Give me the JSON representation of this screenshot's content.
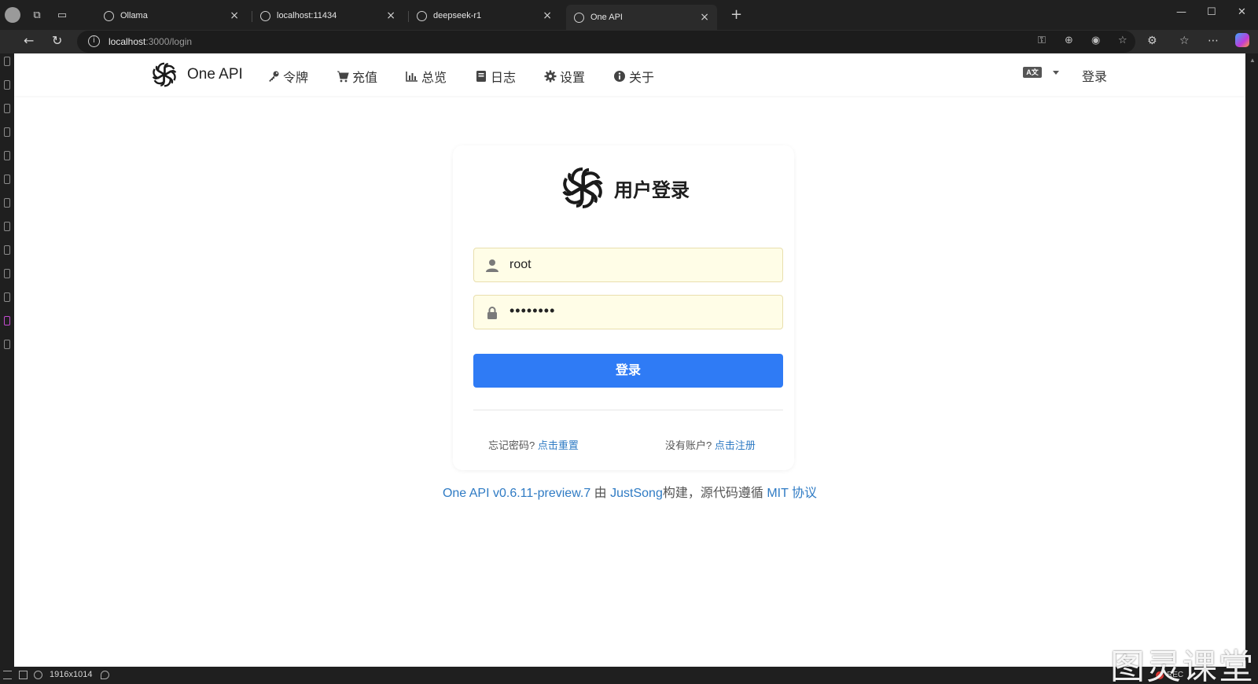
{
  "browser": {
    "tabs": [
      {
        "title": "Ollama"
      },
      {
        "title": "localhost:11434"
      },
      {
        "title": "deepseek-r1"
      },
      {
        "title": "One API"
      }
    ],
    "url_host": "localhost",
    "url_path": ":3000/login"
  },
  "header": {
    "brand": "One API",
    "nav": [
      {
        "label": "令牌",
        "icon": "key-icon"
      },
      {
        "label": "充值",
        "icon": "cart-icon"
      },
      {
        "label": "总览",
        "icon": "bar-chart-icon"
      },
      {
        "label": "日志",
        "icon": "book-icon"
      },
      {
        "label": "设置",
        "icon": "gear-icon"
      },
      {
        "label": "关于",
        "icon": "info-icon"
      }
    ],
    "login": "登录"
  },
  "login_form": {
    "title": "用户登录",
    "username": "root",
    "password_mask": "••••••••",
    "submit": "登录",
    "forgot_text": "忘记密码?",
    "forgot_link": "点击重置",
    "no_account_text": "没有账户?",
    "register_link": "点击注册"
  },
  "footer": {
    "version_link": "One API v0.6.11-preview.7",
    "by": "由",
    "author": "JustSong",
    "built": "构建，源代码遵循",
    "license": "MIT 协议"
  },
  "statusbar": {
    "resolution": "1916x1014",
    "rec": "REC"
  },
  "watermark": "图灵课堂",
  "colors": {
    "primary": "#2f7bf5",
    "link": "#2f7bc4",
    "autofill": "#fffde7"
  }
}
